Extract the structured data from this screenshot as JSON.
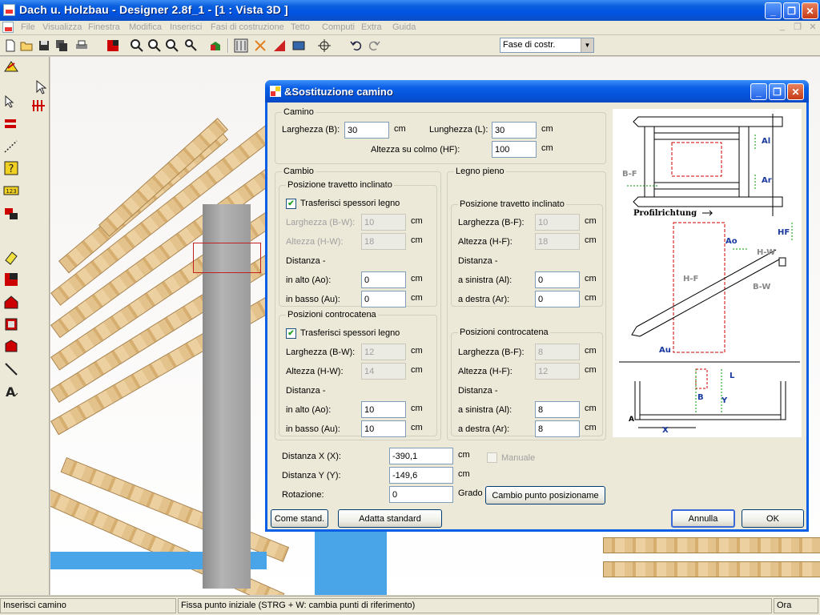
{
  "app": {
    "title": "Dach u. Holzbau - Designer 2.8f_1 - [1 : Vista 3D ]",
    "window_buttons": {
      "minimize": "_",
      "restore": "❐",
      "close": "✕"
    }
  },
  "menu": {
    "items": [
      "File",
      "Visualizza",
      "Finestra",
      "Modifica",
      "Inserisci",
      "Fasi di costruzione",
      "Tetto",
      "Computi",
      "Extra",
      "Guida"
    ],
    "mdi_buttons": [
      "_",
      "❐",
      "✕"
    ]
  },
  "toolbar": {
    "phase_select": "Fase di costr.",
    "arrow": "▼"
  },
  "status": {
    "left": "Inserisci camino",
    "middle": "Fissa punto iniziale (STRG + W: cambia punti di riferimento)",
    "right": "Ora"
  },
  "dialog": {
    "title": "&Sostituzione camino",
    "camino": {
      "label": "Camino",
      "larghezza_label": "Larghezza (B):",
      "larghezza_value": "30",
      "lunghezza_label": "Lunghezza (L):",
      "lunghezza_value": "30",
      "altezza_label": "Altezza su colmo (HF):",
      "altezza_value": "100"
    },
    "unit": "cm",
    "cambio": {
      "label": "Cambio",
      "travetto": {
        "label": "Posizione travetto inclinato",
        "trasferisci": "Trasferisci spessori legno",
        "larghezza_label": "Larghezza (B-W):",
        "larghezza_value": "10",
        "altezza_label": "Altezza (H-W):",
        "altezza_value": "18",
        "distanza_label": "Distanza -",
        "alto_label": "in alto (Ao):",
        "alto_value": "0",
        "basso_label": "in basso (Au):",
        "basso_value": "0"
      },
      "controcatena": {
        "label": "Posizioni controcatena",
        "trasferisci": "Trasferisci spessori legno",
        "larghezza_label": "Larghezza (B-W):",
        "larghezza_value": "12",
        "altezza_label": "Altezza (H-W):",
        "altezza_value": "14",
        "distanza_label": "Distanza -",
        "alto_label": "in alto (Ao):",
        "alto_value": "10",
        "basso_label": "in basso (Au):",
        "basso_value": "10"
      }
    },
    "legno": {
      "label": "Legno pieno",
      "travetto": {
        "label": "Posizione travetto inclinato",
        "larghezza_label": "Larghezza (B-F):",
        "larghezza_value": "10",
        "altezza_label": "Altezza (H-F):",
        "altezza_value": "18",
        "distanza_label": "Distanza -",
        "sinistra_label": "a sinistra (Al):",
        "sinistra_value": "0",
        "destra_label": "a destra (Ar):",
        "destra_value": "0"
      },
      "controcatena": {
        "label": "Posizioni controcatena",
        "larghezza_label": "Larghezza (B-F):",
        "larghezza_value": "8",
        "altezza_label": "Altezza (H-F):",
        "altezza_value": "12",
        "distanza_label": "Distanza -",
        "sinistra_label": "a sinistra (Al):",
        "sinistra_value": "8",
        "destra_label": "a destra (Ar):",
        "destra_value": "8"
      }
    },
    "position": {
      "x_label": "Distanza X (X):",
      "x_value": "-390,1",
      "y_label": "Distanza Y (Y):",
      "y_value": "-149,6",
      "rot_label": "Rotazione:",
      "rot_value": "0",
      "rot_unit": "Grado",
      "manuale": "Manuale",
      "cambio_btn": "Cambio  punto posizioname"
    },
    "buttons": {
      "come_stand": "Come stand.",
      "adatta": "Adatta standard",
      "annulla": "Annulla",
      "ok": "OK"
    },
    "diagram_labels": {
      "al": "Al",
      "ar": "Ar",
      "bf": "B-F",
      "profil": "Profilrichtung",
      "hf": "HF",
      "ao": "Ao",
      "hw": "H-W",
      "hf2": "H-F",
      "bw": "B-W",
      "au": "Au",
      "l": "L",
      "b": "B",
      "y": "Y",
      "a": "A",
      "x": "X"
    }
  }
}
